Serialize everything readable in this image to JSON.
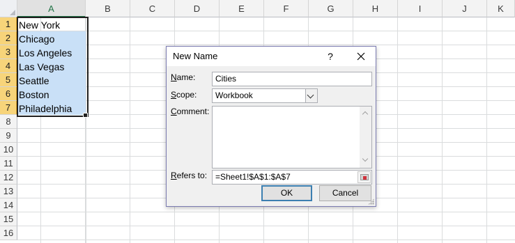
{
  "sheet": {
    "columns": [
      "A",
      "B",
      "C",
      "D",
      "E",
      "F",
      "G",
      "H",
      "I",
      "J",
      "K"
    ],
    "rows": [
      "1",
      "2",
      "3",
      "4",
      "5",
      "6",
      "7",
      "8",
      "9",
      "10",
      "11",
      "12",
      "13",
      "14",
      "15",
      "16"
    ],
    "cells_a": [
      "New York",
      "Chicago",
      "Los Angeles",
      "Las Vegas",
      "Seattle",
      "Boston",
      "Philadelphia"
    ]
  },
  "dialog": {
    "title": "New Name",
    "help": "?",
    "name_label_key": "N",
    "name_label_rest": "ame:",
    "name_value": "Cities",
    "scope_label_key": "S",
    "scope_label_rest": "cope:",
    "scope_value": "Workbook",
    "comment_label_key": "C",
    "comment_label_rest": "omment:",
    "comment_value": "",
    "refers_label_key": "R",
    "refers_label_rest": "efers to:",
    "refers_value": "=Sheet1!$A$1:$A$7",
    "ok_label": "OK",
    "cancel_label": "Cancel"
  },
  "colors": {
    "selection_fill": "#c9e0f7",
    "selected_header": "#f7d47a",
    "excel_green": "#217346",
    "default_button_border": "#3c7fb1"
  }
}
